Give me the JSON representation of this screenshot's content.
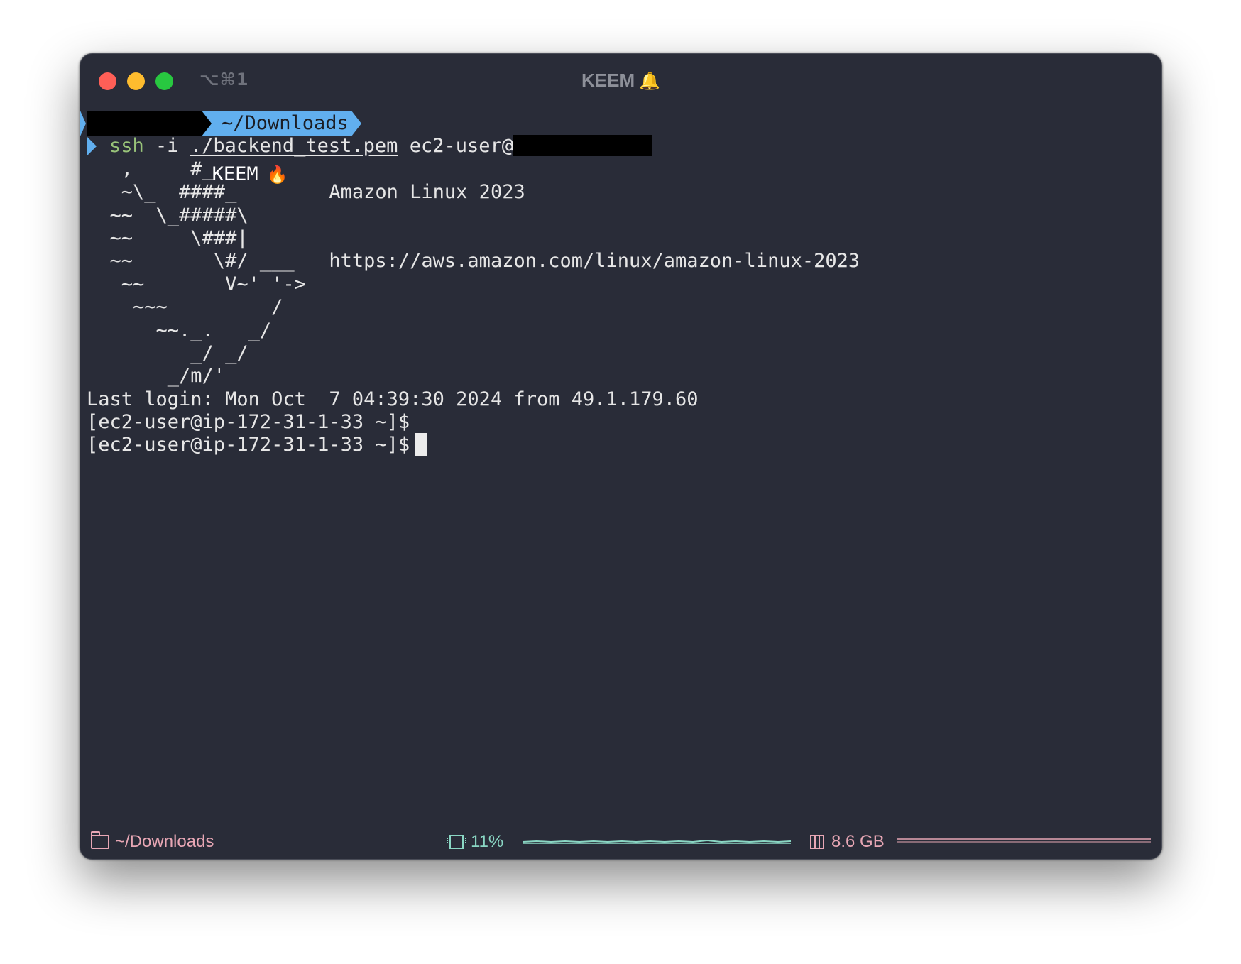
{
  "window": {
    "shortcut": "⌥⌘1",
    "title": "KEEM",
    "title_icon": "bell-icon"
  },
  "prompt": {
    "user": "KEEM",
    "user_icon": "fire-icon",
    "path": "~/Downloads"
  },
  "command": {
    "ssh": "ssh",
    "flag": "-i",
    "keyfile": "./backend_test.pem",
    "target": "ec2-user@"
  },
  "banner": {
    "lines": [
      "   ,     #_",
      "   ~\\_  ####_        Amazon Linux 2023",
      "  ~~  \\_#####\\",
      "  ~~     \\###|",
      "  ~~       \\#/ ___   https://aws.amazon.com/linux/amazon-linux-2023",
      "   ~~       V~' '->",
      "    ~~~         /",
      "      ~~._.   _/",
      "         _/ _/",
      "       _/m/'"
    ]
  },
  "output": {
    "last_login": "Last login: Mon Oct  7 04:39:30 2024 from 49.1.179.60",
    "prompt_line_1": "[ec2-user@ip-172-31-1-33 ~]$",
    "prompt_line_2": "[ec2-user@ip-172-31-1-33 ~]$"
  },
  "statusbar": {
    "cwd": "~/Downloads",
    "cpu": "11%",
    "memory": "8.6 GB"
  },
  "colors": {
    "background": "#292c38",
    "accent_blue": "#61afef",
    "ssh_green": "#98c379",
    "status_pink": "#e8a7b5",
    "status_teal": "#8ad7c4"
  }
}
